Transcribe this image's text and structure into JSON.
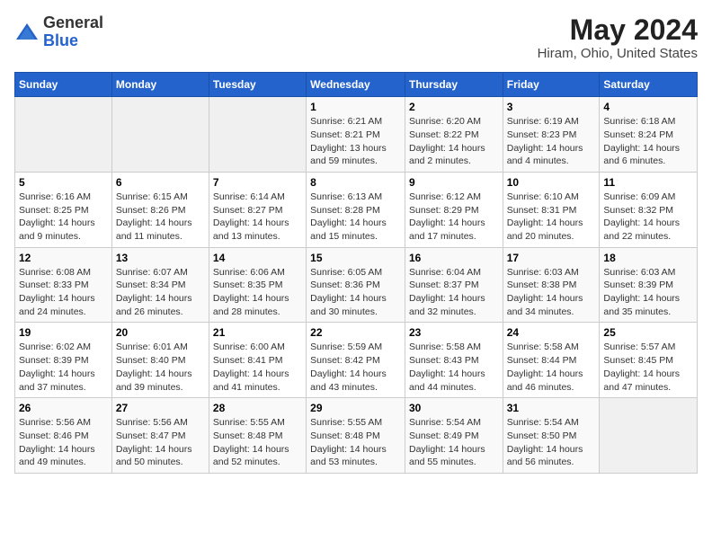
{
  "header": {
    "logo_general": "General",
    "logo_blue": "Blue",
    "title": "May 2024",
    "subtitle": "Hiram, Ohio, United States"
  },
  "weekdays": [
    "Sunday",
    "Monday",
    "Tuesday",
    "Wednesday",
    "Thursday",
    "Friday",
    "Saturday"
  ],
  "weeks": [
    [
      {
        "num": "",
        "info": ""
      },
      {
        "num": "",
        "info": ""
      },
      {
        "num": "",
        "info": ""
      },
      {
        "num": "1",
        "info": "Sunrise: 6:21 AM\nSunset: 8:21 PM\nDaylight: 13 hours and 59 minutes."
      },
      {
        "num": "2",
        "info": "Sunrise: 6:20 AM\nSunset: 8:22 PM\nDaylight: 14 hours and 2 minutes."
      },
      {
        "num": "3",
        "info": "Sunrise: 6:19 AM\nSunset: 8:23 PM\nDaylight: 14 hours and 4 minutes."
      },
      {
        "num": "4",
        "info": "Sunrise: 6:18 AM\nSunset: 8:24 PM\nDaylight: 14 hours and 6 minutes."
      }
    ],
    [
      {
        "num": "5",
        "info": "Sunrise: 6:16 AM\nSunset: 8:25 PM\nDaylight: 14 hours and 9 minutes."
      },
      {
        "num": "6",
        "info": "Sunrise: 6:15 AM\nSunset: 8:26 PM\nDaylight: 14 hours and 11 minutes."
      },
      {
        "num": "7",
        "info": "Sunrise: 6:14 AM\nSunset: 8:27 PM\nDaylight: 14 hours and 13 minutes."
      },
      {
        "num": "8",
        "info": "Sunrise: 6:13 AM\nSunset: 8:28 PM\nDaylight: 14 hours and 15 minutes."
      },
      {
        "num": "9",
        "info": "Sunrise: 6:12 AM\nSunset: 8:29 PM\nDaylight: 14 hours and 17 minutes."
      },
      {
        "num": "10",
        "info": "Sunrise: 6:10 AM\nSunset: 8:31 PM\nDaylight: 14 hours and 20 minutes."
      },
      {
        "num": "11",
        "info": "Sunrise: 6:09 AM\nSunset: 8:32 PM\nDaylight: 14 hours and 22 minutes."
      }
    ],
    [
      {
        "num": "12",
        "info": "Sunrise: 6:08 AM\nSunset: 8:33 PM\nDaylight: 14 hours and 24 minutes."
      },
      {
        "num": "13",
        "info": "Sunrise: 6:07 AM\nSunset: 8:34 PM\nDaylight: 14 hours and 26 minutes."
      },
      {
        "num": "14",
        "info": "Sunrise: 6:06 AM\nSunset: 8:35 PM\nDaylight: 14 hours and 28 minutes."
      },
      {
        "num": "15",
        "info": "Sunrise: 6:05 AM\nSunset: 8:36 PM\nDaylight: 14 hours and 30 minutes."
      },
      {
        "num": "16",
        "info": "Sunrise: 6:04 AM\nSunset: 8:37 PM\nDaylight: 14 hours and 32 minutes."
      },
      {
        "num": "17",
        "info": "Sunrise: 6:03 AM\nSunset: 8:38 PM\nDaylight: 14 hours and 34 minutes."
      },
      {
        "num": "18",
        "info": "Sunrise: 6:03 AM\nSunset: 8:39 PM\nDaylight: 14 hours and 35 minutes."
      }
    ],
    [
      {
        "num": "19",
        "info": "Sunrise: 6:02 AM\nSunset: 8:39 PM\nDaylight: 14 hours and 37 minutes."
      },
      {
        "num": "20",
        "info": "Sunrise: 6:01 AM\nSunset: 8:40 PM\nDaylight: 14 hours and 39 minutes."
      },
      {
        "num": "21",
        "info": "Sunrise: 6:00 AM\nSunset: 8:41 PM\nDaylight: 14 hours and 41 minutes."
      },
      {
        "num": "22",
        "info": "Sunrise: 5:59 AM\nSunset: 8:42 PM\nDaylight: 14 hours and 43 minutes."
      },
      {
        "num": "23",
        "info": "Sunrise: 5:58 AM\nSunset: 8:43 PM\nDaylight: 14 hours and 44 minutes."
      },
      {
        "num": "24",
        "info": "Sunrise: 5:58 AM\nSunset: 8:44 PM\nDaylight: 14 hours and 46 minutes."
      },
      {
        "num": "25",
        "info": "Sunrise: 5:57 AM\nSunset: 8:45 PM\nDaylight: 14 hours and 47 minutes."
      }
    ],
    [
      {
        "num": "26",
        "info": "Sunrise: 5:56 AM\nSunset: 8:46 PM\nDaylight: 14 hours and 49 minutes."
      },
      {
        "num": "27",
        "info": "Sunrise: 5:56 AM\nSunset: 8:47 PM\nDaylight: 14 hours and 50 minutes."
      },
      {
        "num": "28",
        "info": "Sunrise: 5:55 AM\nSunset: 8:48 PM\nDaylight: 14 hours and 52 minutes."
      },
      {
        "num": "29",
        "info": "Sunrise: 5:55 AM\nSunset: 8:48 PM\nDaylight: 14 hours and 53 minutes."
      },
      {
        "num": "30",
        "info": "Sunrise: 5:54 AM\nSunset: 8:49 PM\nDaylight: 14 hours and 55 minutes."
      },
      {
        "num": "31",
        "info": "Sunrise: 5:54 AM\nSunset: 8:50 PM\nDaylight: 14 hours and 56 minutes."
      },
      {
        "num": "",
        "info": ""
      }
    ]
  ]
}
